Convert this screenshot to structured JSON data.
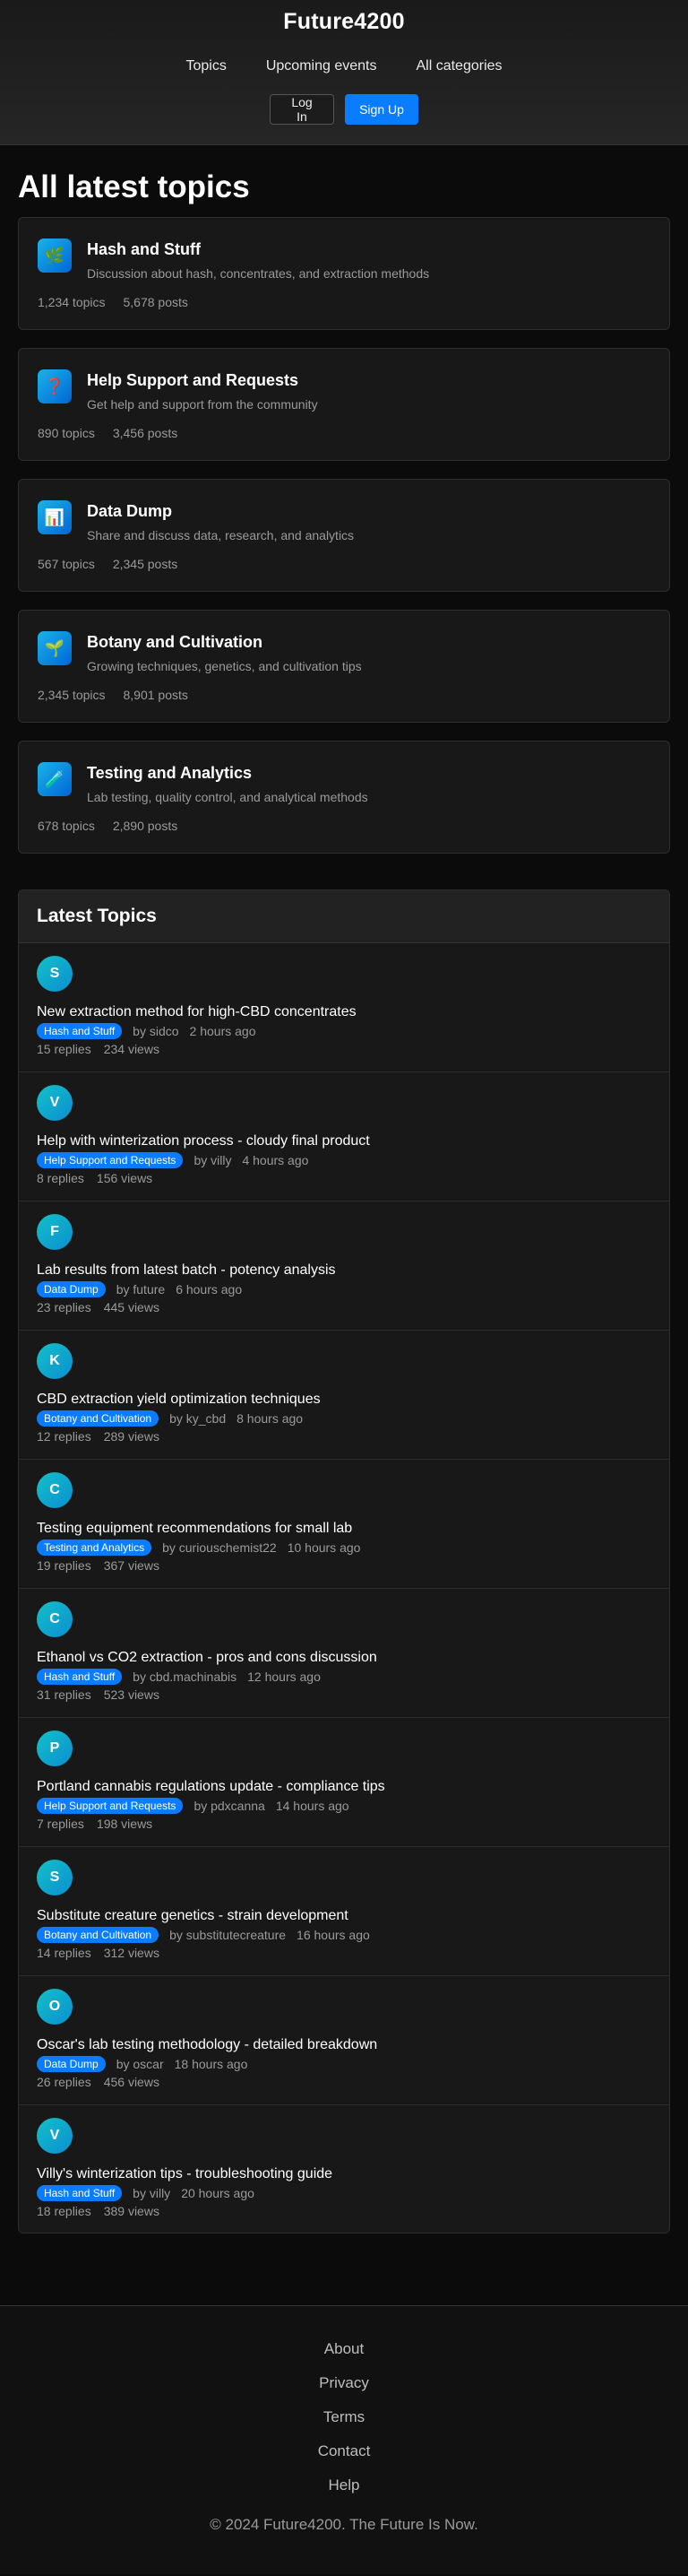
{
  "header": {
    "brand": "Future4200",
    "nav": [
      {
        "label": "Topics"
      },
      {
        "label": "Upcoming events"
      },
      {
        "label": "All categories"
      }
    ],
    "login_label": "Log In",
    "signup_label": "Sign Up"
  },
  "page_title": "All latest topics",
  "categories": [
    {
      "icon": "leaf-icon",
      "glyph": "🌿",
      "name": "Hash and Stuff",
      "desc": "Discussion about hash, concentrates, and extraction methods",
      "topics": "1,234 topics",
      "posts": "5,678 posts"
    },
    {
      "icon": "question-icon",
      "glyph": "❓",
      "name": "Help Support and Requests",
      "desc": "Get help and support from the community",
      "topics": "890 topics",
      "posts": "3,456 posts"
    },
    {
      "icon": "chart-icon",
      "glyph": "📊",
      "name": "Data Dump",
      "desc": "Share and discuss data, research, and analytics",
      "topics": "567 topics",
      "posts": "2,345 posts"
    },
    {
      "icon": "seedling-icon",
      "glyph": "🌱",
      "name": "Botany and Cultivation",
      "desc": "Growing techniques, genetics, and cultivation tips",
      "topics": "2,345 topics",
      "posts": "8,901 posts"
    },
    {
      "icon": "test-tube-icon",
      "glyph": "🧪",
      "name": "Testing and Analytics",
      "desc": "Lab testing, quality control, and analytical methods",
      "topics": "678 topics",
      "posts": "2,890 posts"
    }
  ],
  "latest": {
    "heading": "Latest Topics",
    "topics": [
      {
        "avatar": "S",
        "title": "New extraction method for high-CBD concentrates",
        "category": "Hash and Stuff",
        "author": "by sidco",
        "time": "2 hours ago",
        "replies": "15 replies",
        "views": "234 views"
      },
      {
        "avatar": "V",
        "title": "Help with winterization process - cloudy final product",
        "category": "Help Support and Requests",
        "author": "by villy",
        "time": "4 hours ago",
        "replies": "8 replies",
        "views": "156 views"
      },
      {
        "avatar": "F",
        "title": "Lab results from latest batch - potency analysis",
        "category": "Data Dump",
        "author": "by future",
        "time": "6 hours ago",
        "replies": "23 replies",
        "views": "445 views"
      },
      {
        "avatar": "K",
        "title": "CBD extraction yield optimization techniques",
        "category": "Botany and Cultivation",
        "author": "by ky_cbd",
        "time": "8 hours ago",
        "replies": "12 replies",
        "views": "289 views"
      },
      {
        "avatar": "C",
        "title": "Testing equipment recommendations for small lab",
        "category": "Testing and Analytics",
        "author": "by curiouschemist22",
        "time": "10 hours ago",
        "replies": "19 replies",
        "views": "367 views"
      },
      {
        "avatar": "C",
        "title": "Ethanol vs CO2 extraction - pros and cons discussion",
        "category": "Hash and Stuff",
        "author": "by cbd.machinabis",
        "time": "12 hours ago",
        "replies": "31 replies",
        "views": "523 views"
      },
      {
        "avatar": "P",
        "title": "Portland cannabis regulations update - compliance tips",
        "category": "Help Support and Requests",
        "author": "by pdxcanna",
        "time": "14 hours ago",
        "replies": "7 replies",
        "views": "198 views"
      },
      {
        "avatar": "S",
        "title": "Substitute creature genetics - strain development",
        "category": "Botany and Cultivation",
        "author": "by substitutecreature",
        "time": "16 hours ago",
        "replies": "14 replies",
        "views": "312 views"
      },
      {
        "avatar": "O",
        "title": "Oscar's lab testing methodology - detailed breakdown",
        "category": "Data Dump",
        "author": "by oscar",
        "time": "18 hours ago",
        "replies": "26 replies",
        "views": "456 views"
      },
      {
        "avatar": "V",
        "title": "Villy's winterization tips - troubleshooting guide",
        "category": "Hash and Stuff",
        "author": "by villy",
        "time": "20 hours ago",
        "replies": "18 replies",
        "views": "389 views"
      }
    ]
  },
  "footer": {
    "links": [
      {
        "label": "About"
      },
      {
        "label": "Privacy"
      },
      {
        "label": "Terms"
      },
      {
        "label": "Contact"
      },
      {
        "label": "Help"
      }
    ],
    "copyright": "© 2024 Future4200. The Future Is Now."
  },
  "colors": {
    "accent": "#0a7cff",
    "background": "#0b0b0b",
    "card": "#181818"
  }
}
